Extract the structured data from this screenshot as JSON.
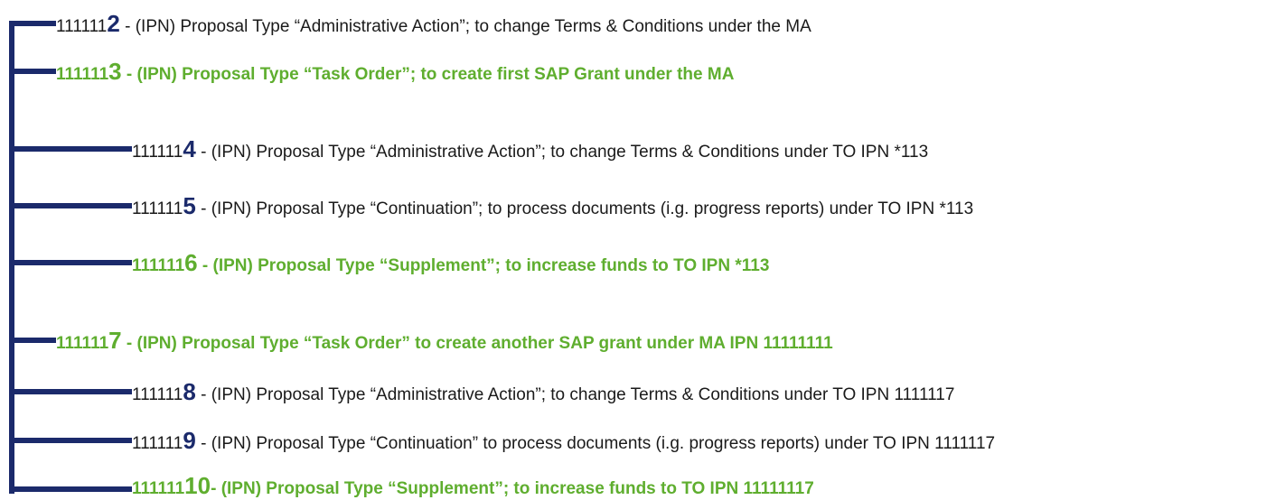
{
  "rows": [
    {
      "prefix": "111111",
      "big": "2",
      "rest": " - (IPN) Proposal Type “Administrative Action”; to change Terms & Conditions under the MA",
      "highlight": false
    },
    {
      "prefix": "111111",
      "big": "3",
      "rest": " - (IPN) Proposal Type “Task Order”; to create first SAP Grant under the MA",
      "highlight": true
    },
    {
      "prefix": "111111",
      "big": "4",
      "rest": " - (IPN) Proposal Type “Administrative Action”; to change Terms & Conditions under TO IPN *113",
      "highlight": false
    },
    {
      "prefix": "111111",
      "big": "5",
      "rest": " - (IPN) Proposal Type “Continuation”; to process documents (i.g. progress reports) under TO IPN *113",
      "highlight": false
    },
    {
      "prefix": "111111",
      "big": "6",
      "rest": " - (IPN) Proposal Type “Supplement”; to increase funds to TO IPN *113",
      "highlight": true
    },
    {
      "prefix": "111111",
      "big": "7",
      "rest": " - (IPN) Proposal Type “Task Order” to create another SAP grant under MA IPN 11111111",
      "highlight": true
    },
    {
      "prefix": "111111",
      "big": "8",
      "rest": " - (IPN) Proposal Type “Administrative Action”; to change Terms & Conditions under TO IPN 1111117",
      "highlight": false
    },
    {
      "prefix": "111111",
      "big": "9",
      "rest": " - (IPN) Proposal Type “Continuation” to process documents (i.g. progress reports) under TO IPN 1111117",
      "highlight": false
    },
    {
      "prefix": "111111",
      "big": "10",
      "rest": "- (IPN) Proposal Type “Supplement”; to increase funds to TO IPN 11111117",
      "highlight": true
    }
  ],
  "colors": {
    "line": "#1b2a6b",
    "highlight": "#5fae2f",
    "text": "#1a1a1a"
  }
}
